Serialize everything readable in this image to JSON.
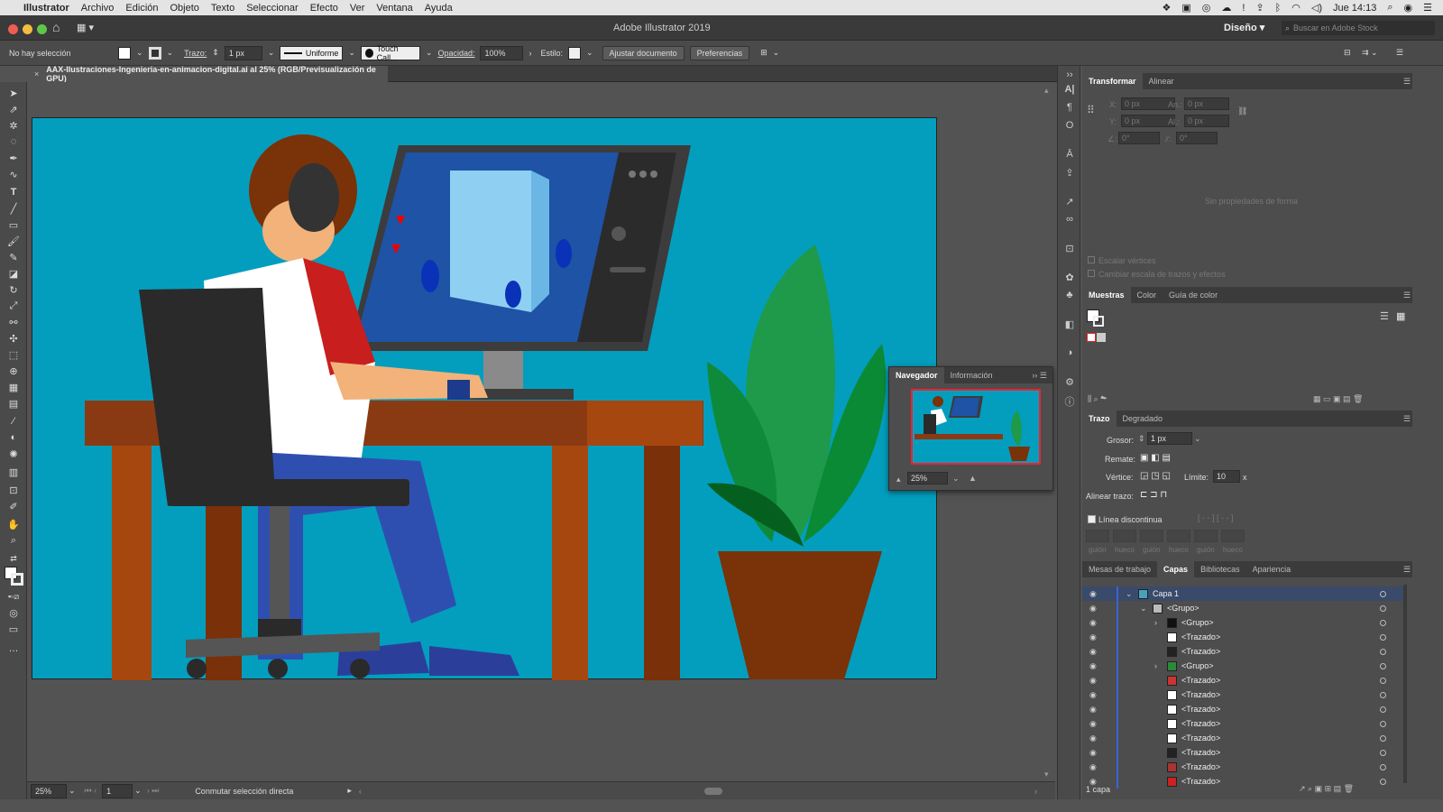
{
  "menubar": {
    "app": "Illustrator",
    "items": [
      "Archivo",
      "Edición",
      "Objeto",
      "Texto",
      "Seleccionar",
      "Efecto",
      "Ver",
      "Ventana",
      "Ayuda"
    ],
    "clock": "Jue 14:13"
  },
  "titlebar": {
    "title": "Adobe Illustrator 2019",
    "workspace": "Diseño",
    "stock_search_placeholder": "Buscar en Adobe Stock"
  },
  "controlbar": {
    "selection": "No hay selección",
    "stroke_label": "Trazo:",
    "stroke_value": "1 px",
    "profile": "Uniforme",
    "brush": "Touch Call...",
    "opacity_label": "Opacidad:",
    "opacity_value": "100%",
    "style_label": "Estilo:",
    "fit_doc_button": "Ajustar documento",
    "prefs_button": "Preferencias"
  },
  "document": {
    "tab_title": "AAX-Ilustraciones-Ingenieria-en-animacion-digital.ai al 25% (RGB/Previsualización de GPU)"
  },
  "statusbar": {
    "zoom": "25%",
    "artboard": "1",
    "tool_hint": "Conmutar selección directa"
  },
  "transform_panel": {
    "tabs": [
      "Transformar",
      "Alinear"
    ],
    "x_label": "X:",
    "x_value": "0 px",
    "y_label": "Y:",
    "y_value": "0 px",
    "w_label": "An.:",
    "w_value": "0 px",
    "h_label": "Al.:",
    "h_value": "0 px",
    "angle_value": "0°",
    "shear_value": "0°",
    "no_shape": "Sin propiedades de forma",
    "scale_corners": "Escalar vértices",
    "scale_strokes": "Cambiar escala de trazos y efectos"
  },
  "swatches_panel": {
    "tabs": [
      "Muestras",
      "Color",
      "Guía de color"
    ]
  },
  "stroke_panel": {
    "tabs": [
      "Trazo",
      "Degradado"
    ],
    "weight_label": "Grosor:",
    "weight_value": "1 px",
    "cap_label": "Remate:",
    "corner_label": "Vértice:",
    "limit_label": "Límite:",
    "limit_value": "10",
    "limit_unit": "x",
    "align_label": "Alinear trazo:",
    "dashed_label": "Línea discontinua",
    "dash_labels": [
      "guión",
      "hueco",
      "guión",
      "hueco",
      "guión",
      "hueco"
    ]
  },
  "layers_panel": {
    "tabs": [
      "Mesas de trabajo",
      "Capas",
      "Bibliotecas",
      "Apariencia"
    ],
    "rows": [
      {
        "name": "Capa 1",
        "indent": 0,
        "expanded": true
      },
      {
        "name": "<Grupo>",
        "indent": 1,
        "expanded": true
      },
      {
        "name": "<Grupo>",
        "indent": 2,
        "expanded": false
      },
      {
        "name": "<Trazado>",
        "indent": 2
      },
      {
        "name": "<Trazado>",
        "indent": 2
      },
      {
        "name": "<Grupo>",
        "indent": 2,
        "expanded": false
      },
      {
        "name": "<Trazado>",
        "indent": 2
      },
      {
        "name": "<Trazado>",
        "indent": 2
      },
      {
        "name": "<Trazado>",
        "indent": 2
      },
      {
        "name": "<Trazado>",
        "indent": 2
      },
      {
        "name": "<Trazado>",
        "indent": 2
      },
      {
        "name": "<Trazado>",
        "indent": 2
      },
      {
        "name": "<Trazado>",
        "indent": 2
      },
      {
        "name": "<Trazado>",
        "indent": 2
      }
    ],
    "footer": "1 capa"
  },
  "navigator_panel": {
    "tabs": [
      "Navegador",
      "Información"
    ],
    "zoom": "25%"
  },
  "colors": {
    "artboard_bg": "#039ebe",
    "accent": "#3c63d6"
  }
}
